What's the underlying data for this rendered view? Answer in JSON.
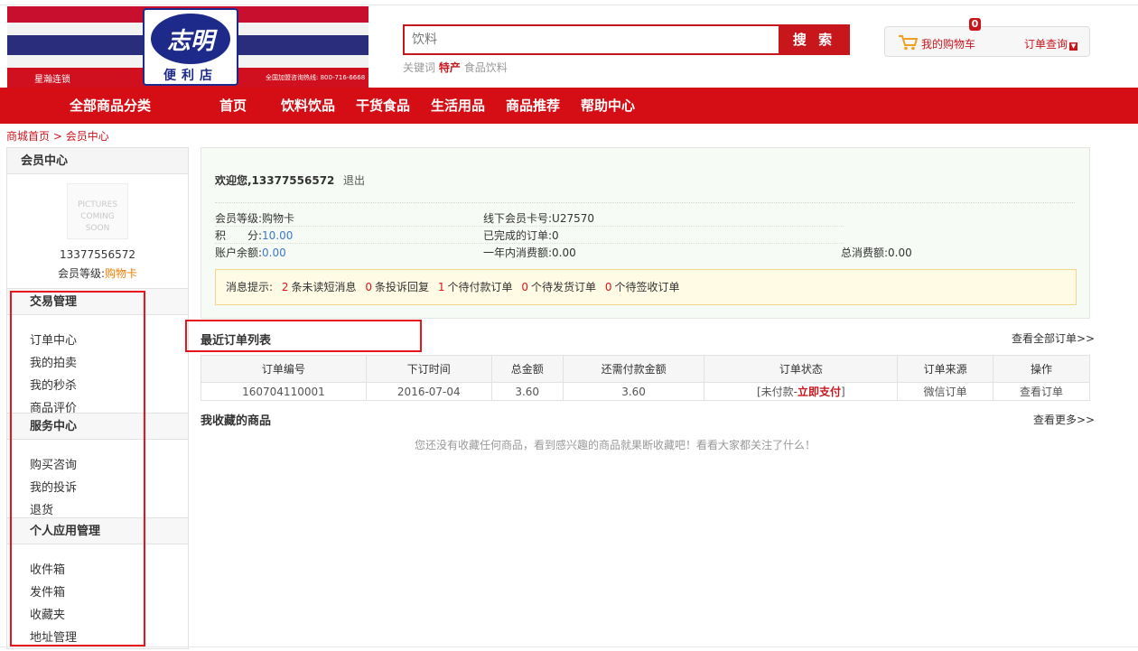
{
  "logo": {
    "script": "志明",
    "shop_name": "便利店",
    "chain_text": "星瀚连锁",
    "hotline": "全国加盟咨询热线: 800-716-6668"
  },
  "search": {
    "placeholder": "饮料",
    "button": "搜 索",
    "hot_label": "关键词",
    "hot_keys": [
      "特产",
      "食品饮料"
    ]
  },
  "cart": {
    "badge": "0",
    "label": "我的购物车",
    "order_query": "订单查询"
  },
  "nav": {
    "all_categories": "全部商品分类",
    "items": [
      "首页",
      "饮料饮品",
      "干货食品",
      "生活用品",
      "商品推荐",
      "帮助中心"
    ]
  },
  "breadcrumb": {
    "home": "商城首页",
    "sep": ">",
    "current": "会员中心"
  },
  "sidebar": {
    "title": "会员中心",
    "avatar_placeholder": [
      "PICTURES",
      "COMING SOON"
    ],
    "phone": "13377556572",
    "level_label": "会员等级:",
    "level_value": "购物卡",
    "groups": [
      {
        "title": "交易管理",
        "links": [
          "订单中心",
          "我的拍卖",
          "我的秒杀",
          "商品评价"
        ]
      },
      {
        "title": "服务中心",
        "links": [
          "购买咨询",
          "我的投诉",
          "退货"
        ]
      },
      {
        "title": "个人应用管理",
        "links": [
          "收件箱",
          "发件箱",
          "收藏夹",
          "地址管理"
        ]
      }
    ]
  },
  "welcome": {
    "hello": "欢迎您,13377556572",
    "logout": "退出",
    "level_label": "会员等级:",
    "level_value": "购物卡",
    "card_label": "线下会员卡号:",
    "card_value": "U27570",
    "points_label": "积　　分:",
    "points_value": "10.00",
    "completed_label": "已完成的订单:",
    "completed_value": "0",
    "balance_label": "账户余额:",
    "balance_value": "0.00",
    "year_spend_label": "一年内消费额:",
    "year_spend_value": "0.00",
    "total_spend_label": "总消费额:",
    "total_spend_value": "0.00"
  },
  "notice": {
    "label": "消息提示:",
    "items": [
      {
        "count": "2",
        "text": "条未读短消息"
      },
      {
        "count": "0",
        "text": "条投诉回复"
      },
      {
        "count": "1",
        "text": "个待付款订单"
      },
      {
        "count": "0",
        "text": "个待发货订单"
      },
      {
        "count": "0",
        "text": "个待签收订单"
      }
    ]
  },
  "orders": {
    "title": "最近订单列表",
    "view_all": "查看全部订单>>",
    "columns": [
      "订单编号",
      "下订时间",
      "总金额",
      "还需付款金额",
      "订单状态",
      "订单来源",
      "操作"
    ],
    "rows": [
      {
        "id": "160704110001",
        "date": "2016-07-04",
        "total": "3.60",
        "due": "3.60",
        "status_prefix": "[未付款-",
        "status_action": "立即支付",
        "status_suffix": "]",
        "source": "微信订单",
        "action": "查看订单"
      }
    ]
  },
  "favorites": {
    "title": "我收藏的商品",
    "more": "查看更多>>",
    "empty": "您还没有收藏任何商品，看到感兴趣的商品就果断收藏吧！看看大家都关注了什么！"
  },
  "colors": {
    "brand_red": "#d40e14",
    "link_blue": "#3a7ac8",
    "level_orange": "#f07d00",
    "highlight_frame": "#e8141b"
  }
}
